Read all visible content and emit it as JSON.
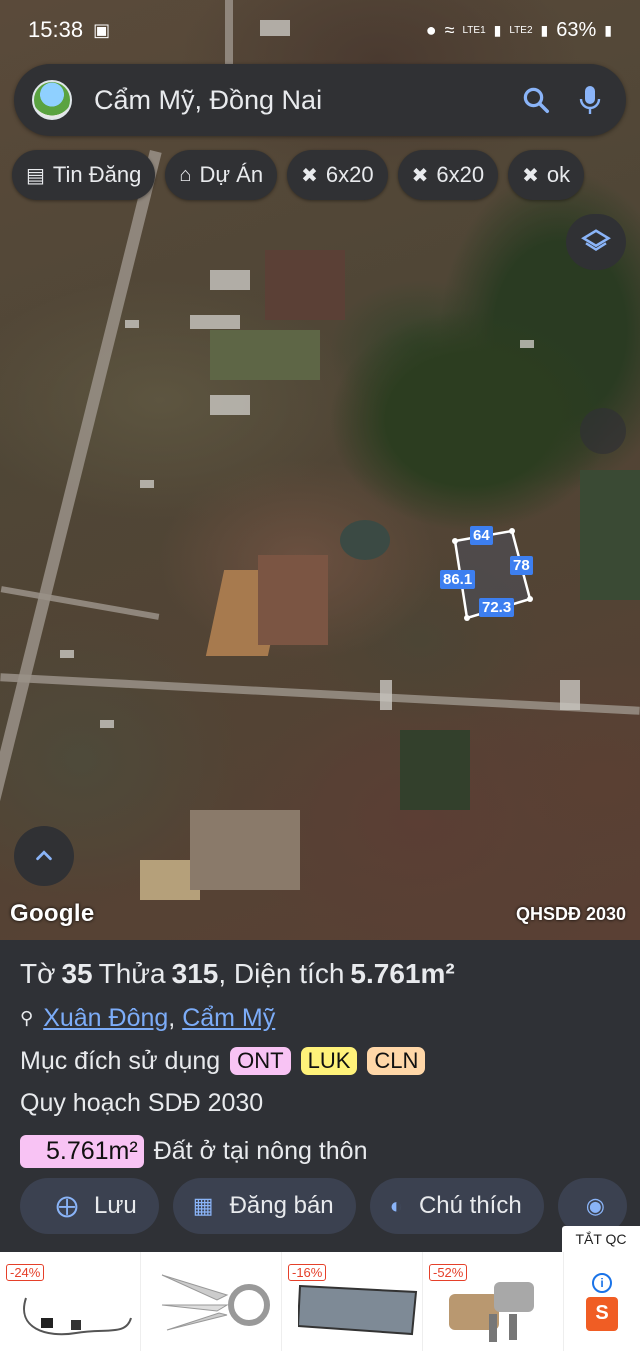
{
  "status_bar": {
    "time": "15:38",
    "battery": "63%",
    "net1": "LTE1",
    "net2": "LTE2"
  },
  "search": {
    "query": "Cẩm Mỹ, Đồng Nai"
  },
  "chips": [
    {
      "icon": "list-icon",
      "label": "Tin Đăng"
    },
    {
      "icon": "building-icon",
      "label": "Dự Án"
    },
    {
      "icon": "ruler-icon",
      "label": "6x20"
    },
    {
      "icon": "ruler-icon",
      "label": "6x20"
    },
    {
      "icon": "ruler-icon",
      "label": "ok"
    }
  ],
  "map": {
    "parcel_dims": {
      "top": "64",
      "right": "78",
      "bottom": "72.3",
      "left": "86.1"
    },
    "attribution": "Google",
    "plan_label": "QHSDĐ 2030"
  },
  "parcel": {
    "to_label": "Tờ",
    "to_value": "35",
    "thua_label": "Thửa",
    "thua_value": "315",
    "area_label": "Diện tích",
    "area_value": "5.761m²",
    "ward": "Xuân Đông",
    "district": "Cẩm Mỹ",
    "purpose_label": "Mục đích sử dụng",
    "purpose_tags": [
      {
        "code": "ONT",
        "color": "#f8c3f4"
      },
      {
        "code": "LUK",
        "color": "#fff27a"
      },
      {
        "code": "CLN",
        "color": "#ffd7a8"
      }
    ],
    "plan_title": "Quy hoạch SDĐ 2030",
    "plan_area": "5.761m²",
    "plan_desc": "Đất ở tại nông thôn"
  },
  "actions": [
    {
      "icon": "save-icon",
      "label": "Lưu"
    },
    {
      "icon": "calendar-icon",
      "label": "Đăng bán"
    },
    {
      "icon": "contrast-icon",
      "label": "Chú thích"
    }
  ],
  "ad": {
    "close_label": "TẮT QC",
    "discounts": [
      "-24%",
      "-16%",
      "-52%"
    ]
  }
}
